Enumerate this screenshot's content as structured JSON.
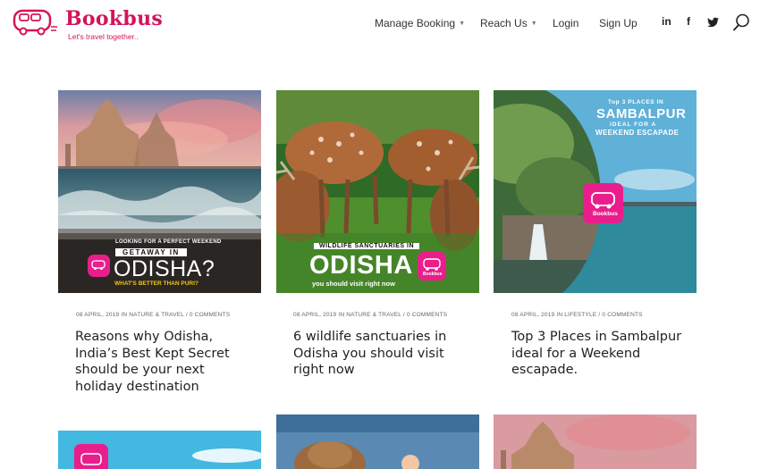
{
  "brand": {
    "name": "Bookbus",
    "tagline": "Let's travel together.."
  },
  "nav": {
    "manage_booking": "Manage Booking",
    "reach_us": "Reach Us",
    "login": "Login",
    "signup": "Sign Up",
    "caret": "▼"
  },
  "social": {
    "linkedin": "in",
    "facebook": "f"
  },
  "posts": [
    {
      "meta": "08 April, 2019 in Nature & Travel / 0 Comments",
      "title": "Reasons why Odisha, India’s Best Kept Secret should be your next holiday destination",
      "image_text": {
        "line1": "LOOKING FOR A PERFECT WEEKEND",
        "line2": "GETAWAY IN",
        "line3": "ODISHA?",
        "line4": "WHAT'S BETTER THAN PURI?"
      }
    },
    {
      "meta": "08 April, 2019 in Nature & Travel / 0 Comments",
      "title": "6 wildlife sanctuaries in Odisha you should visit right now",
      "image_text": {
        "line1": "WILDLIFE SANCTUARIES IN",
        "line2": "ODISHA",
        "line3": "you should visit right now"
      }
    },
    {
      "meta": "08 April, 2019 in Lifestyle / 0 Comments",
      "title": "Top 3 Places in Sambalpur ideal for a Weekend escapade.",
      "image_text": {
        "line1": "Top 3 PLACES IN",
        "line2": "SAMBALPUR",
        "line3": "IDEAL FOR A",
        "line4": "WEEKEND ESCAPADE"
      }
    }
  ],
  "badge_text": "Bookbus",
  "colors": {
    "brand": "#d4145a",
    "badge": "#e91e8c"
  }
}
